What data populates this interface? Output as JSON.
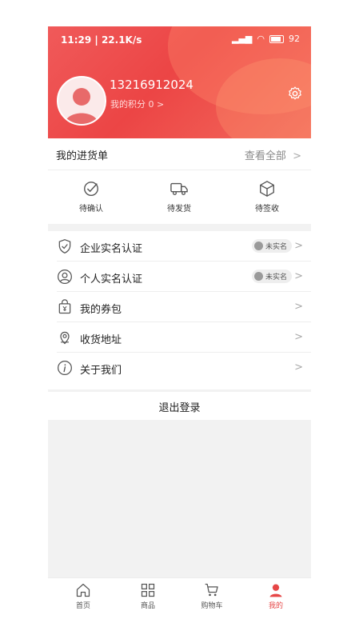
{
  "status_bar": {
    "time": "11:29",
    "network_speed": "22.1K/s",
    "battery": "92"
  },
  "profile": {
    "phone": "13216912024",
    "points_label": "我的积分",
    "points_value": "0",
    "points_chevron": ">"
  },
  "orders": {
    "title": "我的进货单",
    "view_all": "查看全部",
    "chevron": ">",
    "items": [
      {
        "label": "待确认",
        "icon": "check-circle-icon"
      },
      {
        "label": "待发货",
        "icon": "truck-icon"
      },
      {
        "label": "待签收",
        "icon": "package-icon"
      }
    ]
  },
  "menu": {
    "items": [
      {
        "label": "企业实名认证",
        "icon": "shield-icon",
        "badge": "未实名",
        "chevron": ">"
      },
      {
        "label": "个人实名认证",
        "icon": "person-icon",
        "badge": "未实名",
        "chevron": ">"
      },
      {
        "label": "我的券包",
        "icon": "coupon-bag-icon",
        "chevron": ">"
      },
      {
        "label": "收货地址",
        "icon": "location-icon",
        "chevron": ">"
      },
      {
        "label": "关于我们",
        "icon": "info-icon",
        "chevron": ">"
      }
    ]
  },
  "logout_label": "退出登录",
  "tabbar": {
    "items": [
      {
        "label": "首页",
        "icon": "home-icon"
      },
      {
        "label": "商品",
        "icon": "grid-icon"
      },
      {
        "label": "购物车",
        "icon": "cart-icon"
      },
      {
        "label": "我的",
        "icon": "user-icon"
      }
    ],
    "active_color": "#e64646"
  },
  "colors": {
    "brand_red": "#ec4545"
  }
}
